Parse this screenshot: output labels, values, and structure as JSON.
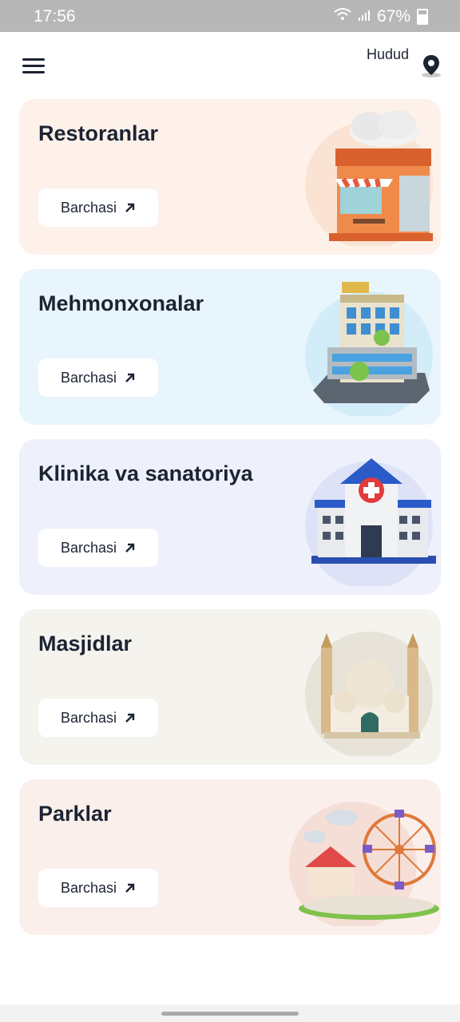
{
  "status": {
    "time": "17:56",
    "battery": "67%"
  },
  "header": {
    "region_label": "Hudud"
  },
  "cards": [
    {
      "title": "Restoranlar",
      "button": "Barchasi",
      "bg": "#fdf1ea"
    },
    {
      "title": "Mehmonxonalar",
      "button": "Barchasi",
      "bg": "#e9f5fd"
    },
    {
      "title": "Klinika va sanatoriya",
      "button": "Barchasi",
      "bg": "#eef0fc"
    },
    {
      "title": "Masjidlar",
      "button": "Barchasi",
      "bg": "#f4f3ee"
    },
    {
      "title": "Parklar",
      "button": "Barchasi",
      "bg": "#fbefeb"
    }
  ]
}
